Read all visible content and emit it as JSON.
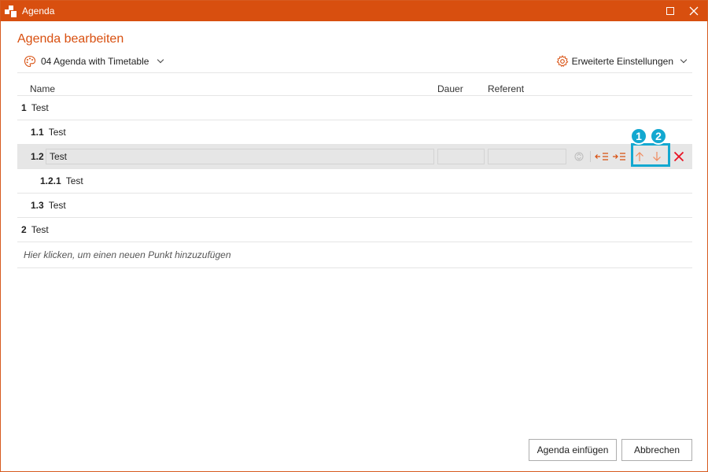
{
  "window": {
    "title": "Agenda"
  },
  "dialog": {
    "heading": "Agenda bearbeiten"
  },
  "toolbar": {
    "template_label": "04 Agenda with Timetable",
    "settings_label": "Erweiterte Einstellungen"
  },
  "table": {
    "headers": {
      "name": "Name",
      "duration": "Dauer",
      "speaker": "Referent"
    },
    "rows": [
      {
        "num": "1",
        "text": "Test"
      },
      {
        "num": "1.1",
        "text": "Test"
      },
      {
        "num": "1.2",
        "text": "Test",
        "duration": "",
        "speaker": ""
      },
      {
        "num": "1.2.1",
        "text": "Test"
      },
      {
        "num": "1.3",
        "text": "Test"
      },
      {
        "num": "2",
        "text": "Test"
      }
    ],
    "add_hint": "Hier klicken, um einen neuen Punkt hinzuzufügen"
  },
  "annotations": {
    "marker1": "1",
    "marker2": "2",
    "accent": "#13a8d0"
  },
  "buttons": {
    "insert": "Agenda einfügen",
    "cancel": "Abbrechen"
  },
  "colors": {
    "brand": "#d84f0f",
    "delete": "#e81123"
  }
}
